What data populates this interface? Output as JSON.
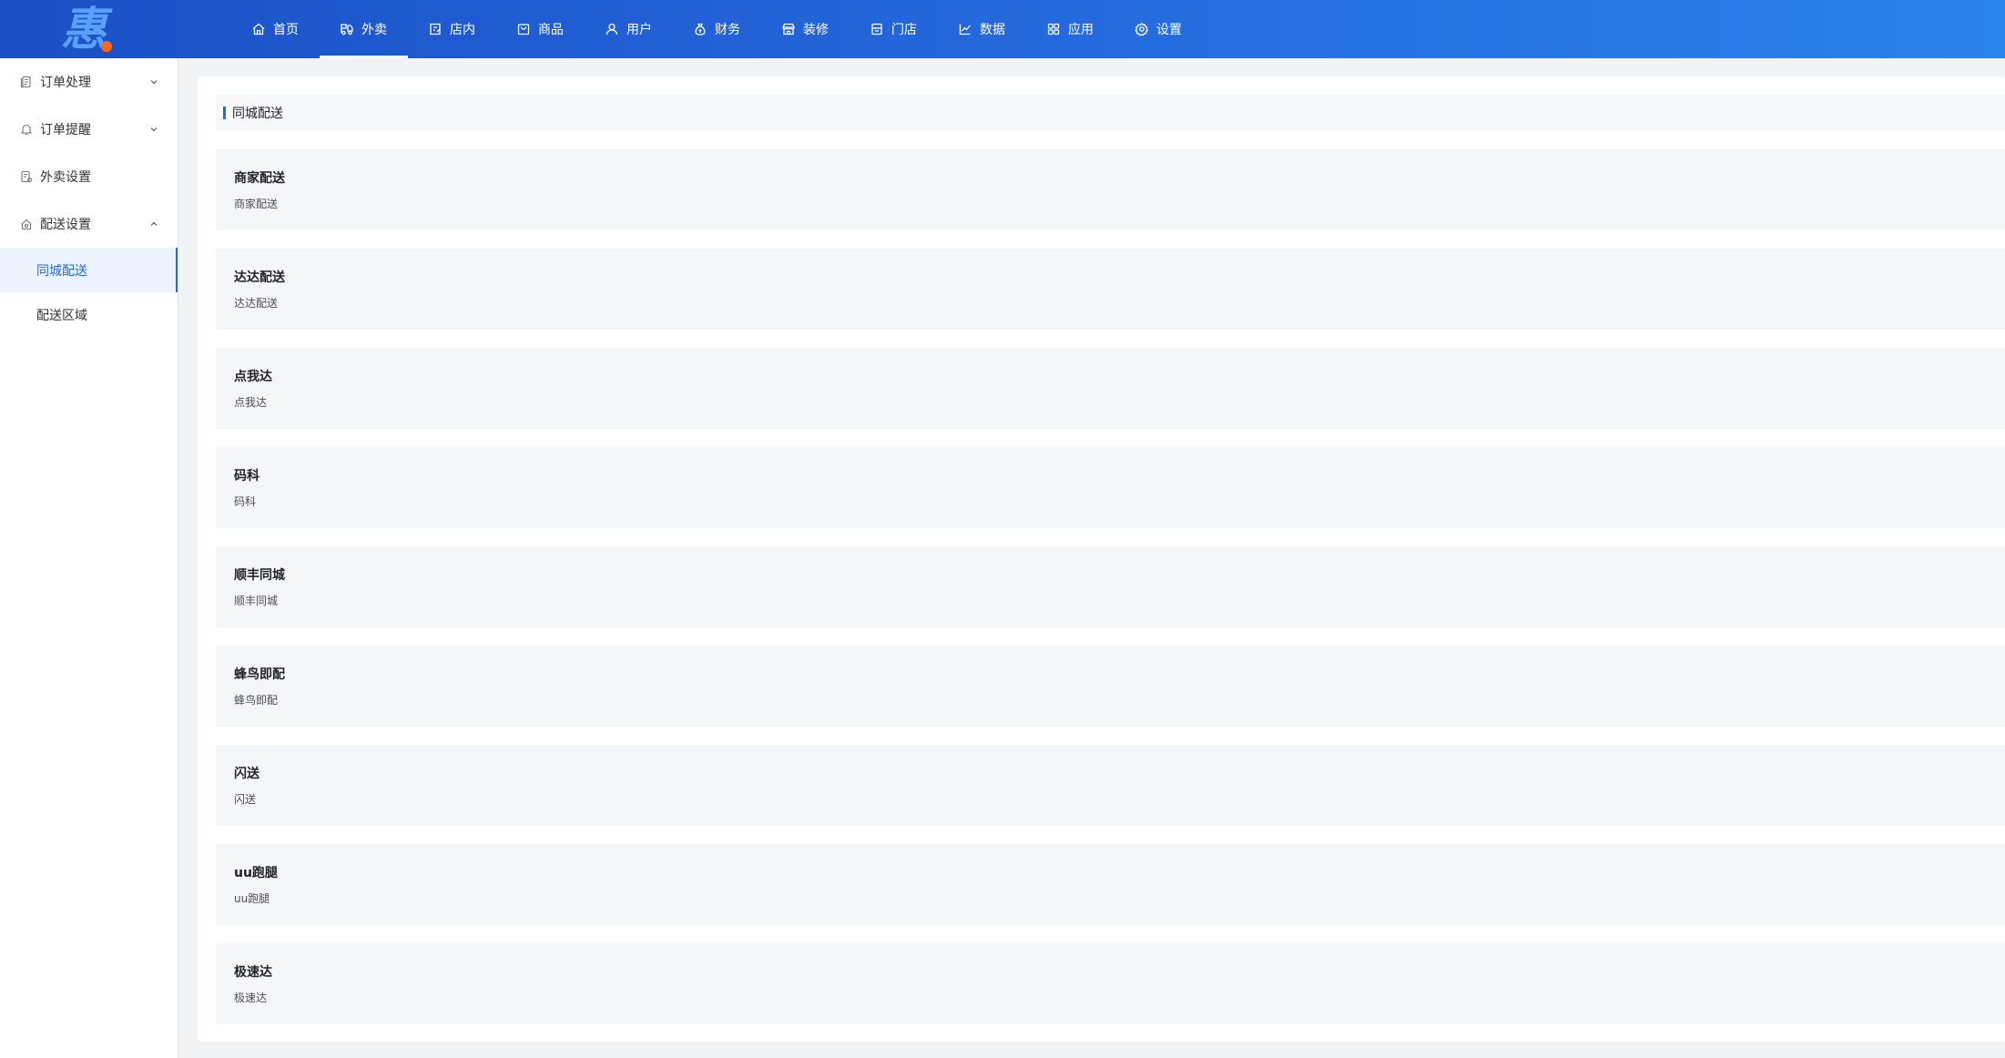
{
  "brand": {
    "logo_text": "惠",
    "accent": "#2468dc",
    "logo_dot_color": "#ff6a1f"
  },
  "topnav": {
    "items": [
      {
        "label": "首页",
        "icon": "home-icon"
      },
      {
        "label": "外卖",
        "icon": "takeaway-icon",
        "active": true
      },
      {
        "label": "店内",
        "icon": "store-icon"
      },
      {
        "label": "商品",
        "icon": "bag-icon"
      },
      {
        "label": "用户",
        "icon": "user-icon"
      },
      {
        "label": "财务",
        "icon": "money-bag-icon"
      },
      {
        "label": "装修",
        "icon": "shop-front-icon"
      },
      {
        "label": "门店",
        "icon": "storefront-icon"
      },
      {
        "label": "数据",
        "icon": "chart-icon"
      },
      {
        "label": "应用",
        "icon": "apps-icon"
      },
      {
        "label": "设置",
        "icon": "gear-icon"
      }
    ]
  },
  "sidebar": {
    "groups": [
      {
        "label": "订单处理",
        "icon": "document-icon",
        "expanded": false
      },
      {
        "label": "订单提醒",
        "icon": "bell-icon",
        "expanded": false
      },
      {
        "label": "外卖设置",
        "icon": "document-settings-icon"
      },
      {
        "label": "配送设置",
        "icon": "delivery-box-icon",
        "expanded": true,
        "children": [
          {
            "label": "同城配送",
            "active": true
          },
          {
            "label": "配送区域"
          }
        ]
      }
    ]
  },
  "main": {
    "section_title": "同城配送",
    "cards": [
      {
        "title": "商家配送",
        "desc": "商家配送"
      },
      {
        "title": "达达配送",
        "desc": "达达配送"
      },
      {
        "title": "点我达",
        "desc": "点我达"
      },
      {
        "title": "码科",
        "desc": "码科"
      },
      {
        "title": "顺丰同城",
        "desc": "顺丰同城"
      },
      {
        "title": "蜂鸟即配",
        "desc": "蜂鸟即配"
      },
      {
        "title": "闪送",
        "desc": "闪送"
      },
      {
        "title": "uu跑腿",
        "desc": "uu跑腿"
      },
      {
        "title": "极速达",
        "desc": "极速达"
      }
    ]
  }
}
